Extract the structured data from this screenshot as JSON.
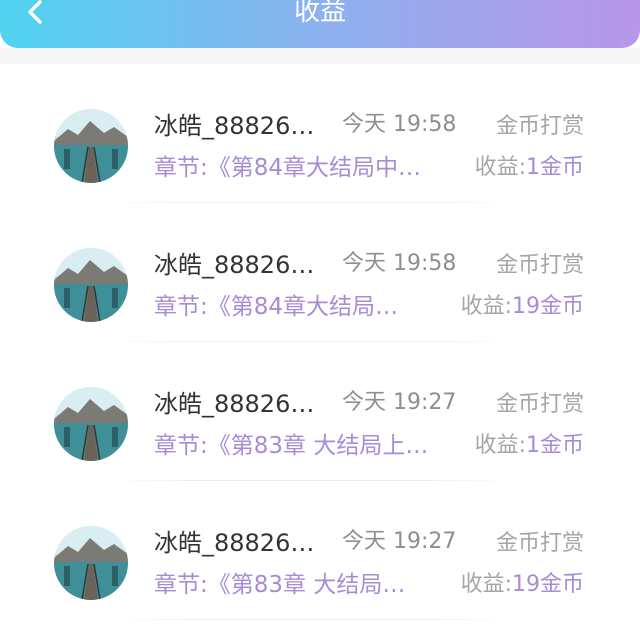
{
  "header": {
    "title": "收益",
    "back_icon": "chevron-left-icon",
    "gradient": [
      "#4fd3f1",
      "#b996ea"
    ]
  },
  "records": [
    {
      "name": "冰皓_88826…",
      "time": "今天 19:58",
      "type": "金币打赏",
      "chapter": "章节:《第84章大结局中…",
      "earn_label": "收益:",
      "earn_value": "1金币"
    },
    {
      "name": "冰皓_88826…",
      "time": "今天 19:58",
      "type": "金币打赏",
      "chapter": "章节:《第84章大结局…",
      "earn_label": "收益:",
      "earn_value": "19金币"
    },
    {
      "name": "冰皓_88826…",
      "time": "今天 19:27",
      "type": "金币打赏",
      "chapter": "章节:《第83章 大结局上…",
      "earn_label": "收益:",
      "earn_value": "1金币"
    },
    {
      "name": "冰皓_88826…",
      "time": "今天 19:27",
      "type": "金币打赏",
      "chapter": "章节:《第83章 大结局…",
      "earn_label": "收益:",
      "earn_value": "19金币"
    }
  ],
  "colors": {
    "accent_purple": "#a88bd6",
    "muted_gray": "#a6a6a6"
  }
}
